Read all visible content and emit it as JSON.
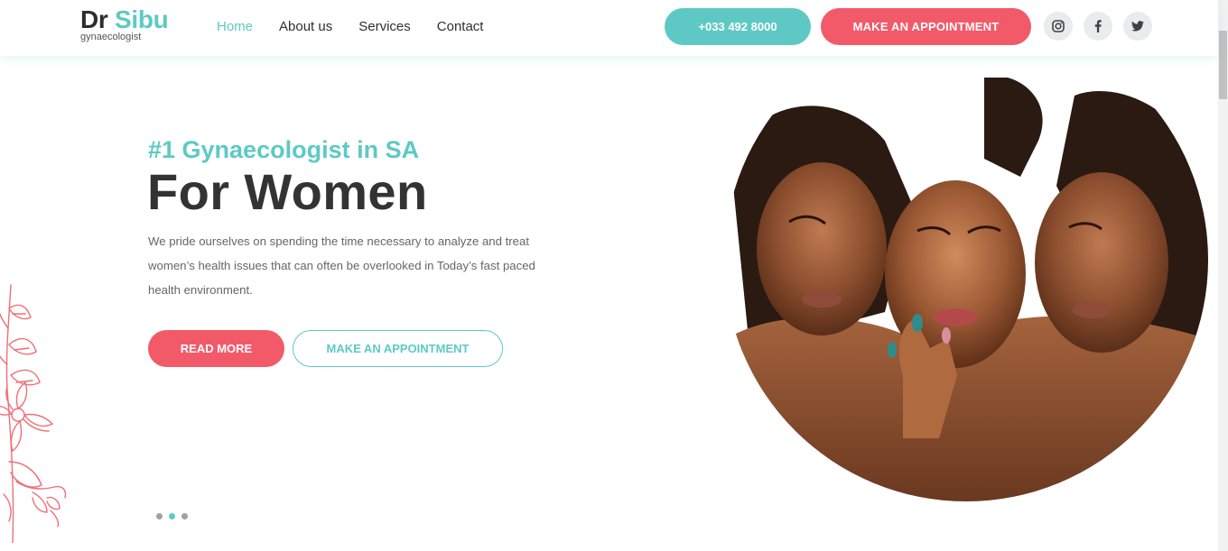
{
  "brand": {
    "name_part1": "Dr",
    "name_part2": "Sibu",
    "subtitle": "gynaecologist"
  },
  "nav": {
    "items": [
      {
        "label": "Home",
        "active": true
      },
      {
        "label": "About us",
        "active": false
      },
      {
        "label": "Services",
        "active": false
      },
      {
        "label": "Contact",
        "active": false
      }
    ]
  },
  "header_actions": {
    "phone": "+033 492 8000",
    "appointment": "MAKE AN APPOINTMENT",
    "social": [
      "instagram-icon",
      "facebook-icon",
      "twitter-icon"
    ]
  },
  "hero": {
    "tagline": "#1 Gynaecologist in SA",
    "headline": "For Women",
    "intro_lines": [
      "We pride ourselves on spending the time necessary to analyze and treat",
      "women’s health issues that can often be overlooked in Today’s fast paced",
      "health environment."
    ],
    "read_more": "READ MORE",
    "appointment": "MAKE AN APPOINTMENT"
  },
  "slider": {
    "count": 3,
    "active_index": 1
  },
  "colors": {
    "teal": "#5ec9c4",
    "coral": "#f25a6a",
    "dark_text": "#333333",
    "muted_text": "#666666",
    "social_bg": "#e8eced"
  }
}
